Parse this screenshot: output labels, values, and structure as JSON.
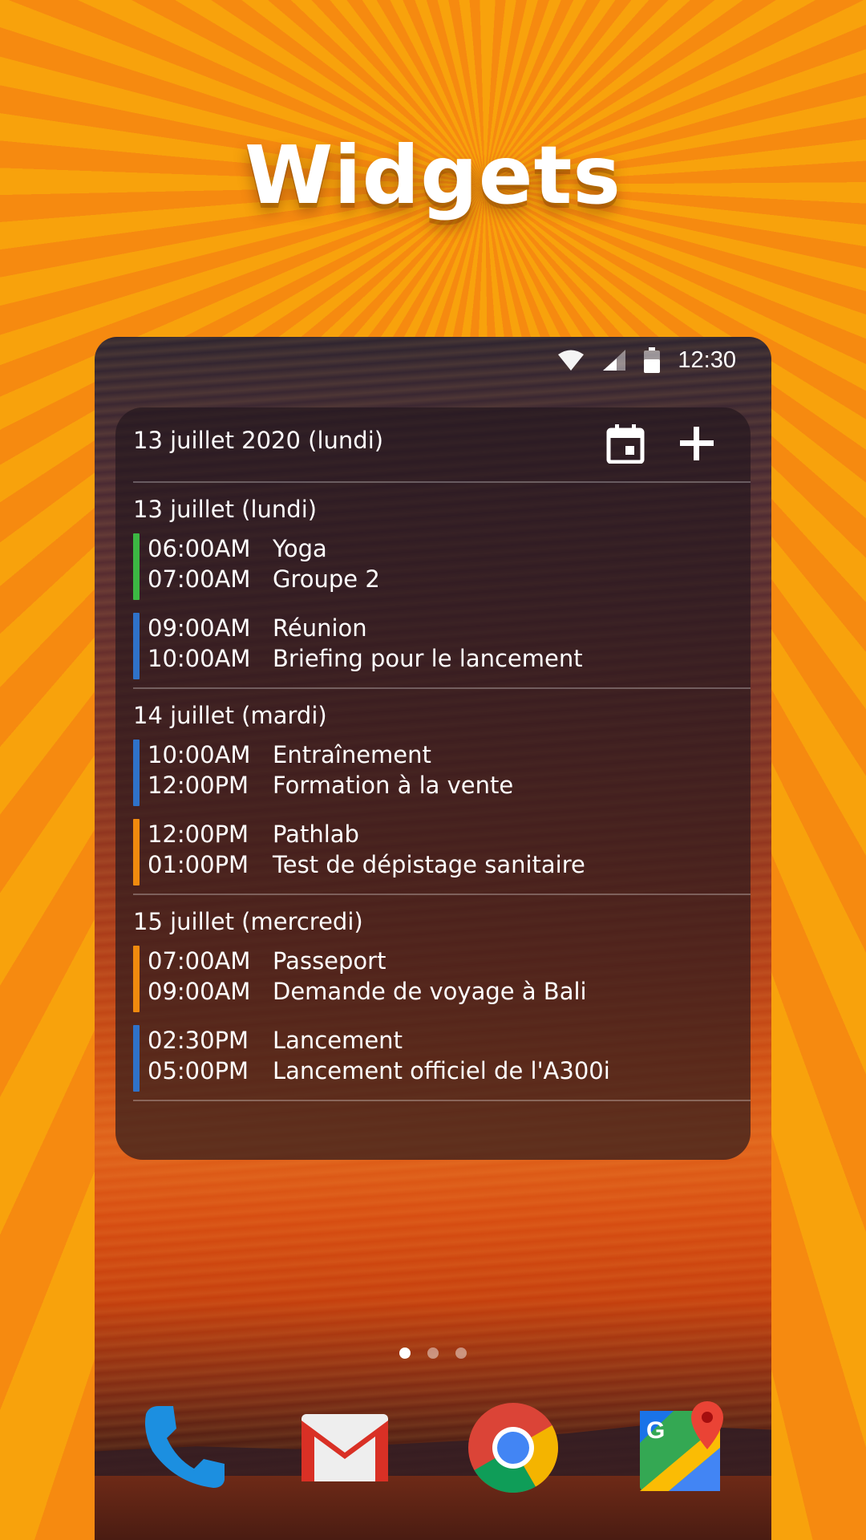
{
  "headline": "Widgets",
  "status_bar": {
    "time": "12:30",
    "icons": [
      "wifi-icon",
      "signal-icon",
      "battery-icon"
    ]
  },
  "widget": {
    "title": "13 juillet 2020 (lundi)",
    "header_icons": [
      "calendar-icon",
      "add-icon"
    ],
    "days": [
      {
        "label": "13 juillet (lundi)",
        "events": [
          {
            "start": "06:00AM",
            "end": "07:00AM",
            "title": "Yoga",
            "subtitle": "Groupe 2",
            "color": "#3cb843"
          },
          {
            "start": "09:00AM",
            "end": "10:00AM",
            "title": "Réunion",
            "subtitle": "Briefing pour le lancement",
            "color": "#2f72c9"
          }
        ]
      },
      {
        "label": "14 juillet (mardi)",
        "events": [
          {
            "start": "10:00AM",
            "end": "12:00PM",
            "title": "Entraînement",
            "subtitle": "Formation à la vente",
            "color": "#2f72c9"
          },
          {
            "start": "12:00PM",
            "end": "01:00PM",
            "title": "Pathlab",
            "subtitle": "Test de dépistage sanitaire",
            "color": "#f08a0e"
          }
        ]
      },
      {
        "label": "15 juillet (mercredi)",
        "events": [
          {
            "start": "07:00AM",
            "end": "09:00AM",
            "title": "Passeport",
            "subtitle": "Demande de voyage à Bali",
            "color": "#f08a0e"
          },
          {
            "start": "02:30PM",
            "end": "05:00PM",
            "title": "Lancement",
            "subtitle": "Lancement officiel de l'A300i",
            "color": "#2f72c9"
          }
        ]
      }
    ]
  },
  "page_indicator": {
    "count": 3,
    "active": 1
  },
  "dock": [
    "phone-app-icon",
    "gmail-app-icon",
    "chrome-app-icon",
    "maps-app-icon"
  ]
}
